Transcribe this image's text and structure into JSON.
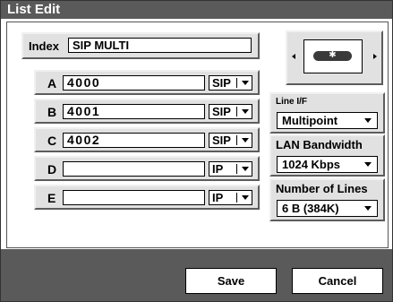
{
  "window": {
    "title": "List Edit"
  },
  "index": {
    "label": "Index",
    "value": "SIP MULTI"
  },
  "entries": [
    {
      "letter": "A",
      "number": "4000",
      "protocol": "SIP"
    },
    {
      "letter": "B",
      "number": "4001",
      "protocol": "SIP"
    },
    {
      "letter": "C",
      "number": "4002",
      "protocol": "SIP"
    },
    {
      "letter": "D",
      "number": "",
      "protocol": "IP"
    },
    {
      "letter": "E",
      "number": "",
      "protocol": "IP"
    }
  ],
  "preview": {
    "center_glyph": "✱"
  },
  "settings": {
    "line_if": {
      "label": "Line I/F",
      "value": "Multipoint"
    },
    "lan_bandwidth": {
      "label": "LAN Bandwidth",
      "value": "1024 Kbps"
    },
    "number_of_lines": {
      "label": "Number of Lines",
      "value": "6 B (384K)"
    }
  },
  "buttons": {
    "save": "Save",
    "cancel": "Cancel"
  },
  "colors": {
    "title_bar": "#5a5a5a",
    "panel": "#e1e1e1",
    "field": "#ffffff"
  }
}
